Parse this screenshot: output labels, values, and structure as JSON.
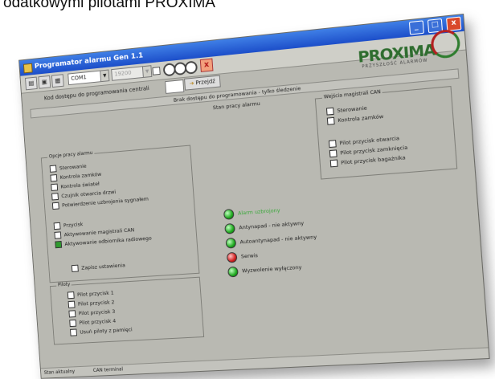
{
  "caption": "odatkowymi pilotami PROXIMA",
  "window": {
    "title": "Programator alarmu Gen 1.1",
    "minimize": "_",
    "maximize": "□",
    "close": "x"
  },
  "toolbar": {
    "port_value": "COM1",
    "speed_value": "19200",
    "cancel_glyph": "x"
  },
  "logo": {
    "brand": "PROXIMA",
    "sub": "PRZYSZŁOŚĆ ALARMÓW"
  },
  "form": {
    "code_label": "Kod dostępu do programowania centrali",
    "code_value": "",
    "go_label": "Przejdź"
  },
  "mode_banner": "Brak dostępu do programowania - tylko śledzenie",
  "status_title": "Stan pracy alarmu",
  "groups": {
    "work_options": {
      "label": "Opcje pracy alarmu",
      "items": [
        {
          "label": "Sterowanie",
          "checked": false
        },
        {
          "label": "Kontrola zamków",
          "checked": false
        },
        {
          "label": "Kontrola świateł",
          "checked": false
        },
        {
          "label": "Czujnik otwarcia drzwi",
          "checked": false
        },
        {
          "label": "Potwierdzenie uzbrojenia sygnałem",
          "checked": false
        },
        {
          "label": "Przycisk",
          "checked": false
        },
        {
          "label": "Aktywowanie magistrali CAN",
          "checked": false
        },
        {
          "label": "Aktywowanie odbiornika radiowego",
          "checked": true
        },
        {
          "label": "Zapisz ustawienia",
          "checked": false
        }
      ]
    },
    "remotes": {
      "label": "Piloty",
      "items": [
        {
          "label": "Pilot przycisk 1",
          "checked": false
        },
        {
          "label": "Pilot przycisk 2",
          "checked": false
        },
        {
          "label": "Pilot przycisk 3",
          "checked": false
        },
        {
          "label": "Pilot przycisk 4",
          "checked": false
        },
        {
          "label": "Usuń piloty z pamięci",
          "checked": false
        }
      ]
    },
    "can_bus": {
      "label": "Wejścia magistrali CAN",
      "items": [
        {
          "label": "Sterowanie",
          "checked": false
        },
        {
          "label": "Kontrola zamków",
          "checked": false
        },
        {
          "label": "Pilot przycisk otwarcia",
          "checked": false
        },
        {
          "label": "Pilot przycisk zamknięcia",
          "checked": false
        },
        {
          "label": "Pilot przycisk bagażnika",
          "checked": false
        }
      ]
    }
  },
  "status_leds": [
    {
      "label": "Alarm uzbrojony",
      "color": "green",
      "highlight": true
    },
    {
      "label": "Antynapad - nie aktywny",
      "color": "green",
      "highlight": false
    },
    {
      "label": "Autoantynapad - nie aktywny",
      "color": "green",
      "highlight": false
    },
    {
      "label": "Serwis",
      "color": "red",
      "highlight": false
    },
    {
      "label": "Wyzwolenie wyłączony",
      "color": "green",
      "highlight": false
    }
  ],
  "statusbar": {
    "tabs": [
      "Stan aktualny",
      "CAN terminal"
    ]
  },
  "colors": {
    "window_bg": "#b9b9b2",
    "titlebar": "#1c4ec9",
    "led_green": "#1fa81f",
    "led_red": "#d11f1f",
    "logo_green": "#2f6d2f",
    "logo_red": "#b42020"
  }
}
